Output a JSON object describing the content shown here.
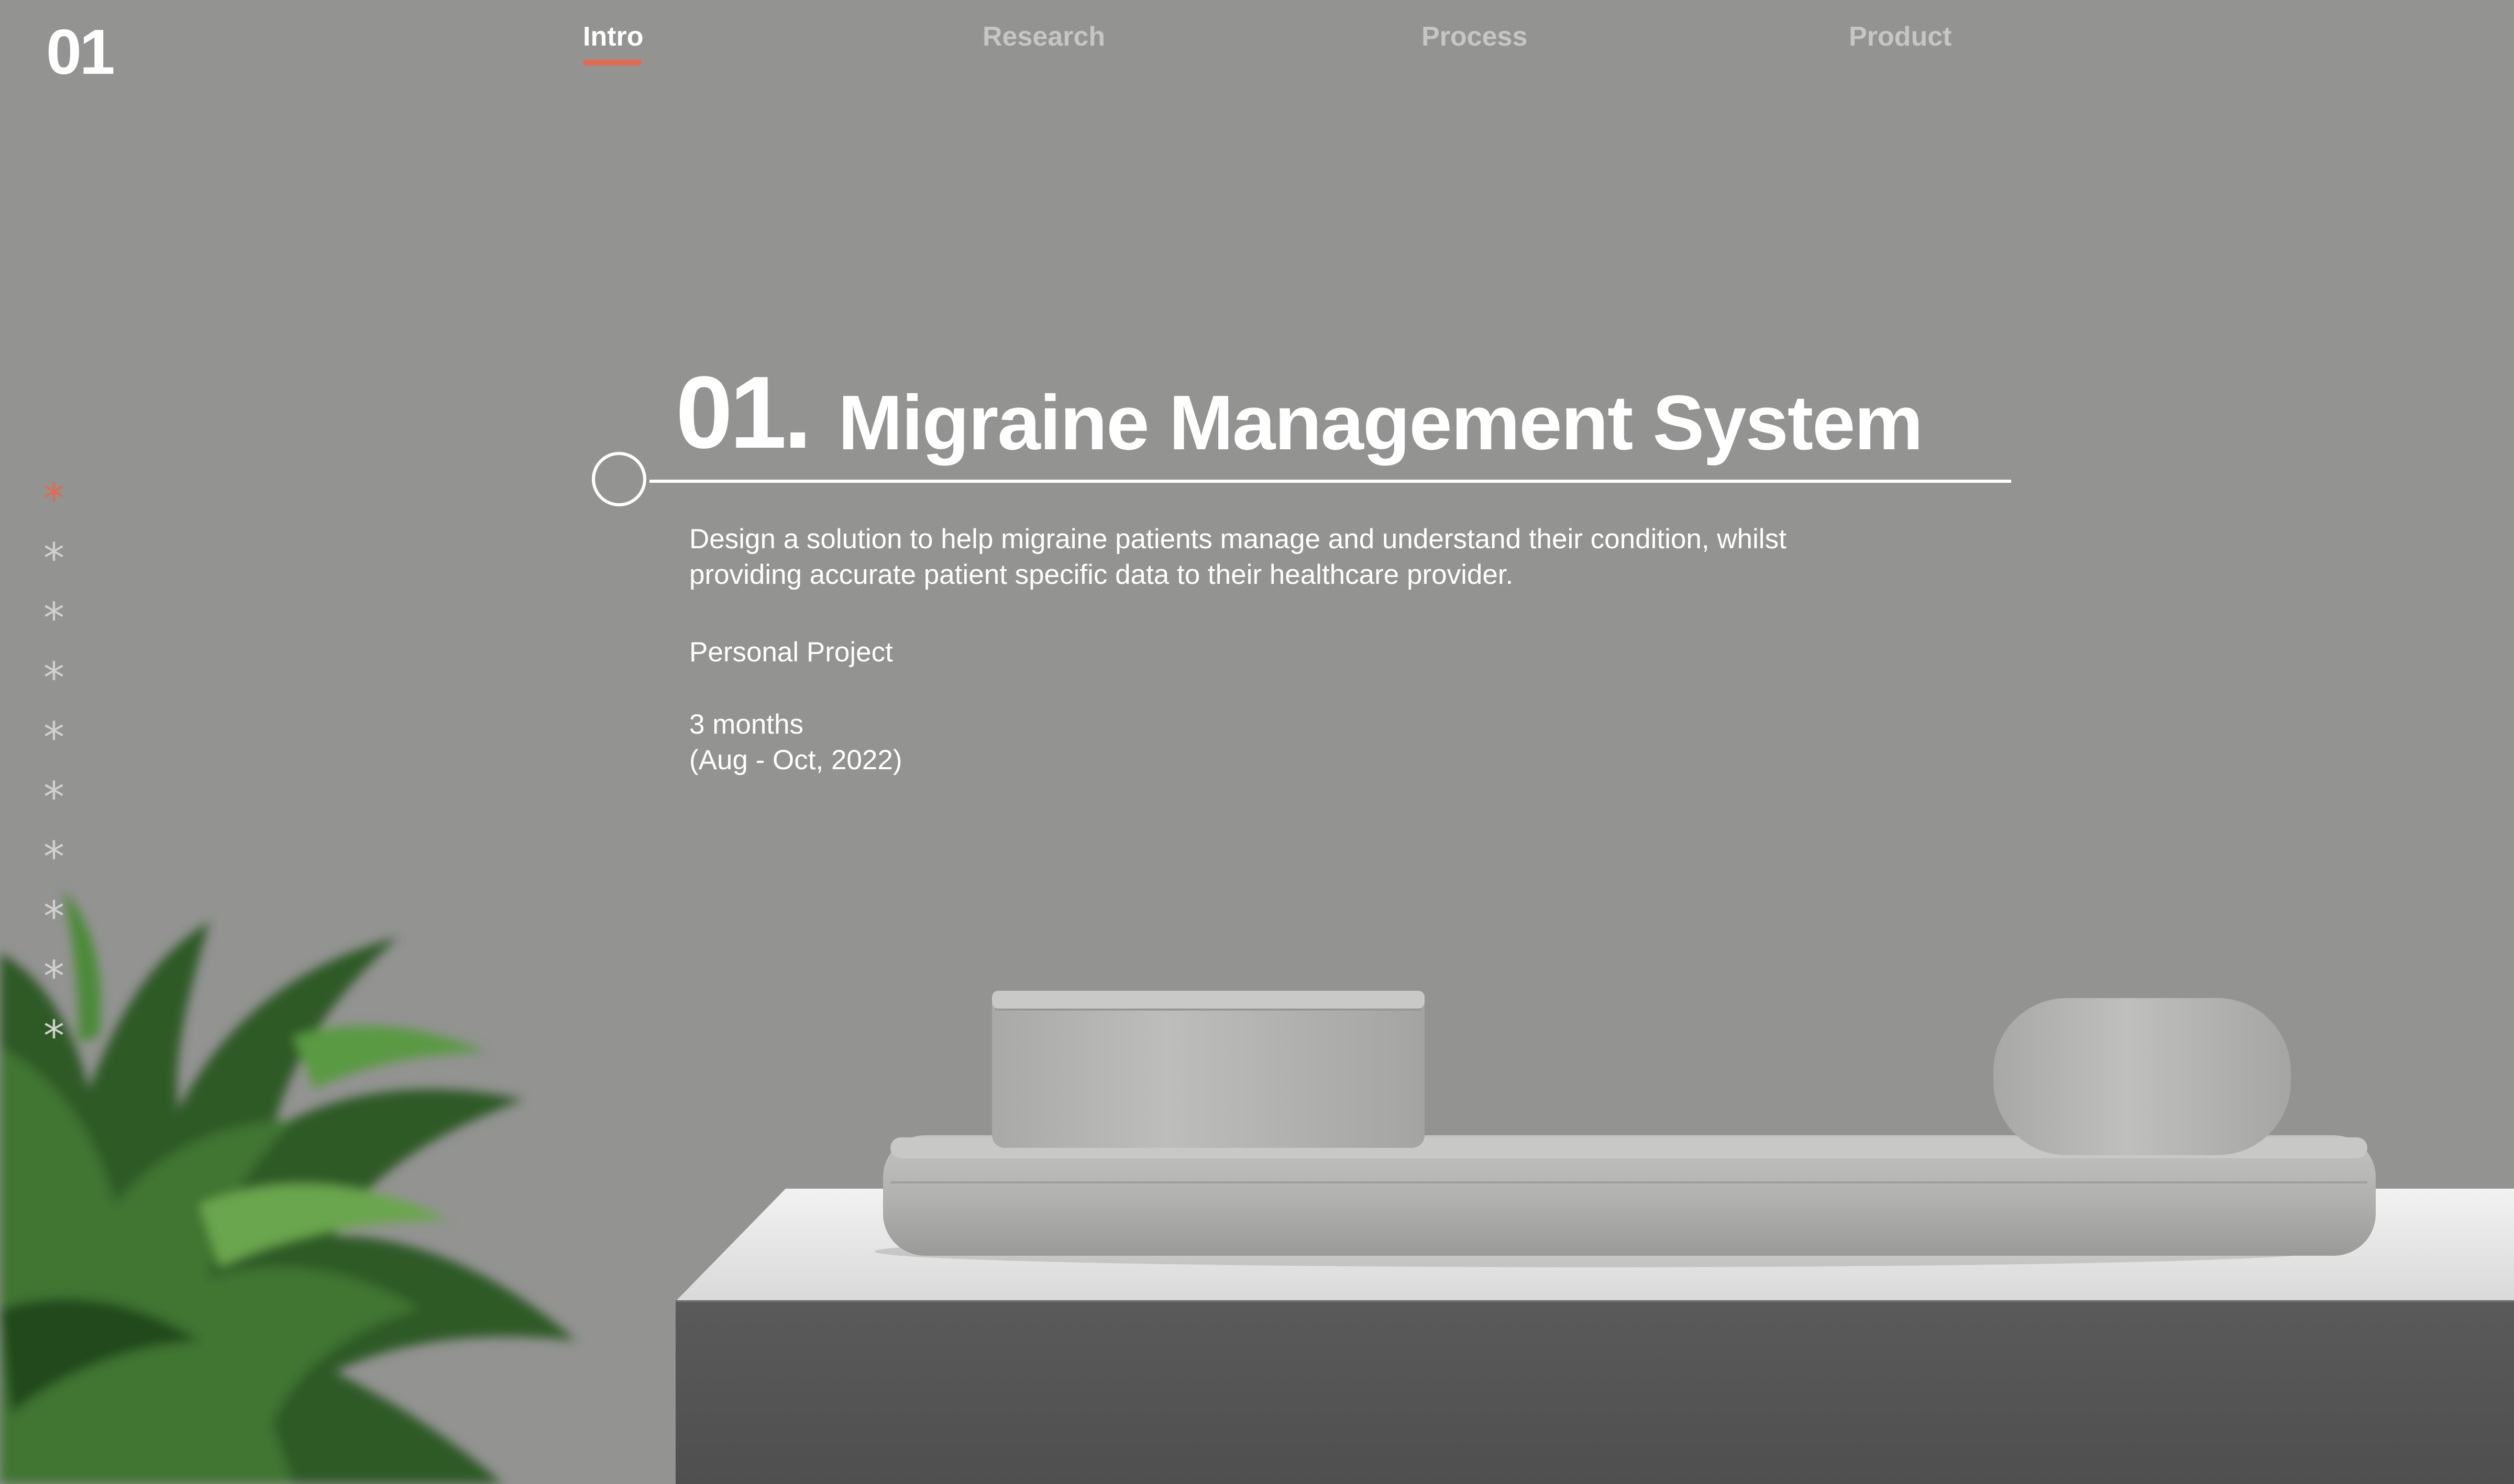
{
  "page_number": "01",
  "nav": {
    "items": [
      {
        "label": "Intro",
        "active": true
      },
      {
        "label": "Research",
        "active": false
      },
      {
        "label": "Process",
        "active": false
      },
      {
        "label": "Product",
        "active": false
      }
    ]
  },
  "side_nav": {
    "stars": [
      "*",
      "*",
      "*",
      "*",
      "*",
      "*",
      "*",
      "*",
      "*",
      "*"
    ],
    "active_index": 0
  },
  "hero": {
    "number": "01.",
    "title": "Migraine Management System",
    "description": "Design a solution to help migraine patients manage and understand their condition, whilst providing accurate patient specific data to their healthcare provider.",
    "project_type": "Personal Project",
    "duration": "3 months",
    "dates": "(Aug - Oct, 2022)"
  },
  "colors": {
    "background": "#939392",
    "accent": "#e36a4f",
    "text": "#ffffff",
    "nav_inactive": "#c6c6c4"
  },
  "scene": {
    "icons": [
      "plant-image",
      "device-base-image",
      "pedestal-image"
    ]
  }
}
